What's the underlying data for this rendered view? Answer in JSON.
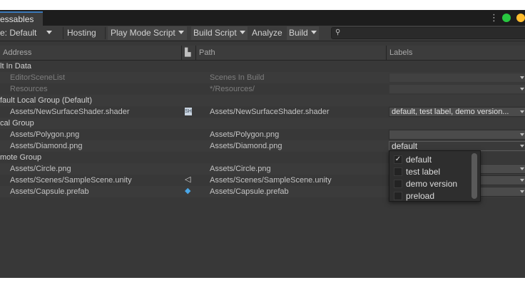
{
  "window": {
    "tab_title": "essables",
    "menu_dots": "⋮"
  },
  "toolbar": {
    "profile_label": "e: Default",
    "hosting": "Hosting",
    "play_mode_script": "Play Mode Script",
    "build_script": "Build Script",
    "analyze": "Analyze",
    "build": "Build",
    "search_placeholder": ""
  },
  "columns": {
    "address": "Address",
    "path": "Path",
    "labels": "Labels"
  },
  "rows": [
    {
      "type": "group",
      "name": "lt In Data"
    },
    {
      "type": "entry",
      "disabled": true,
      "address": "EditorSceneList",
      "path": "Scenes In Build",
      "labels": "",
      "icon": ""
    },
    {
      "type": "entry",
      "disabled": true,
      "address": "Resources",
      "path": "*/Resources/",
      "labels": "",
      "icon": ""
    },
    {
      "type": "group",
      "name": "fault Local Group (Default)"
    },
    {
      "type": "entry",
      "disabled": false,
      "address": "Assets/NewSurfaceShader.shader",
      "path": "Assets/NewSurfaceShader.shader",
      "labels": "default, test label, demo version...",
      "icon": "shader-icon"
    },
    {
      "type": "group",
      "name": "cal Group"
    },
    {
      "type": "entry",
      "disabled": false,
      "address": "Assets/Polygon.png",
      "path": "Assets/Polygon.png",
      "labels": "",
      "icon": ""
    },
    {
      "type": "entry",
      "disabled": false,
      "address": "Assets/Diamond.png",
      "path": "Assets/Diamond.png",
      "labels": "default",
      "icon": ""
    },
    {
      "type": "group",
      "name": "mote Group"
    },
    {
      "type": "entry",
      "disabled": false,
      "address": "Assets/Circle.png",
      "path": "Assets/Circle.png",
      "labels": "",
      "icon": ""
    },
    {
      "type": "entry",
      "disabled": false,
      "address": "Assets/Scenes/SampleScene.unity",
      "path": "Assets/Scenes/SampleScene.unity",
      "labels": "",
      "icon": "unity-scene-icon"
    },
    {
      "type": "entry",
      "disabled": false,
      "address": "Assets/Capsule.prefab",
      "path": "Assets/Capsule.prefab",
      "labels": "",
      "icon": "prefab-cube-icon"
    }
  ],
  "labels_popup": {
    "items": [
      {
        "label": "default",
        "checked": true
      },
      {
        "label": "test label",
        "checked": false
      },
      {
        "label": "demo version",
        "checked": false
      },
      {
        "label": "preload",
        "checked": false
      }
    ]
  },
  "colors": {
    "tab_accent": "#3a79bb",
    "light_green": "#28c840",
    "light_yellow": "#febc2e",
    "prefab_icon": "#4aa7e8"
  }
}
